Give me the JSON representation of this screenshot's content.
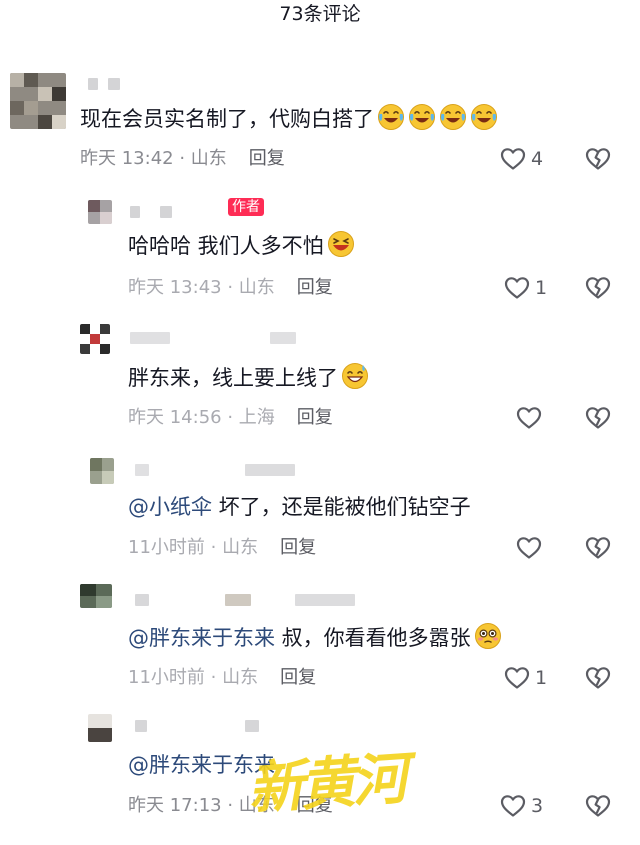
{
  "header": {
    "title": "73条评论"
  },
  "comments": [
    {
      "text": "现在会员实名制了，代购白搭了",
      "time": "昨天 13:42 · 山东",
      "reply": "回复",
      "likes": "4"
    },
    {
      "badge": "作者",
      "text": "哈哈哈 我们人多不怕",
      "time": "昨天 13:43 · 山东",
      "reply": "回复",
      "likes": "1"
    },
    {
      "text": "胖东来，线上要上线了",
      "time": "昨天 14:56 · 上海",
      "reply": "回复",
      "likes": ""
    },
    {
      "mention": "@小纸伞",
      "text": " 坏了，还是能被他们钻空子",
      "time": "11小时前 · 山东",
      "reply": "回复",
      "likes": ""
    },
    {
      "mention": "@胖东来于东来",
      "text": " 叔，你看看他多嚣张",
      "time": "11小时前 · 山东",
      "reply": "回复",
      "likes": "1"
    },
    {
      "mention": "@胖东来于东来",
      "text": "",
      "time": "昨天 17:13 · 山东",
      "reply": "回复",
      "likes": "3"
    }
  ],
  "watermark": "新黄河",
  "colors": {
    "accent_red": "#fe2c55",
    "mention": "#2d4a7a",
    "meta": "#8a8b91",
    "watermark": "#f5d31b"
  },
  "icons": {
    "like": "heart-outline-icon",
    "dislike": "broken-heart-icon",
    "emoji_tears": "laughing-tears-emoji",
    "emoji_laugh": "laughing-emoji",
    "emoji_sweat": "sweat-smile-emoji",
    "emoji_flushed": "flushed-emoji"
  }
}
